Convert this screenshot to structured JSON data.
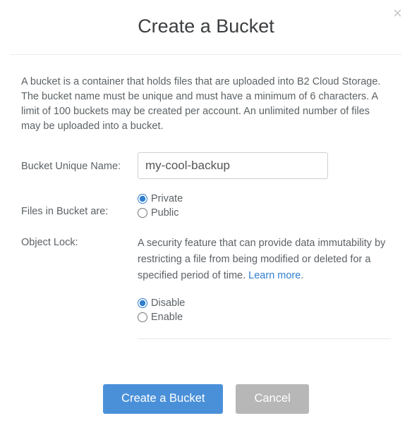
{
  "modal": {
    "title": "Create a Bucket",
    "description": "A bucket is a container that holds files that are uploaded into B2 Cloud Storage. The bucket name must be unique and must have a minimum of 6 characters. A limit of 100 buckets may be created per account. An unlimited number of files may be uploaded into a bucket."
  },
  "form": {
    "name_label": "Bucket Unique Name:",
    "name_value": "my-cool-backup",
    "visibility_label": "Files in Bucket are:",
    "visibility_options": {
      "private": "Private",
      "public": "Public"
    },
    "visibility_selected": "private",
    "object_lock_label": "Object Lock:",
    "object_lock_help": "A security feature that can provide data immutability by restricting a file from being modified or deleted for a specified period of time. ",
    "object_lock_learn_more": "Learn more",
    "object_lock_options": {
      "disable": "Disable",
      "enable": "Enable"
    },
    "object_lock_selected": "disable"
  },
  "buttons": {
    "create": "Create a Bucket",
    "cancel": "Cancel"
  }
}
